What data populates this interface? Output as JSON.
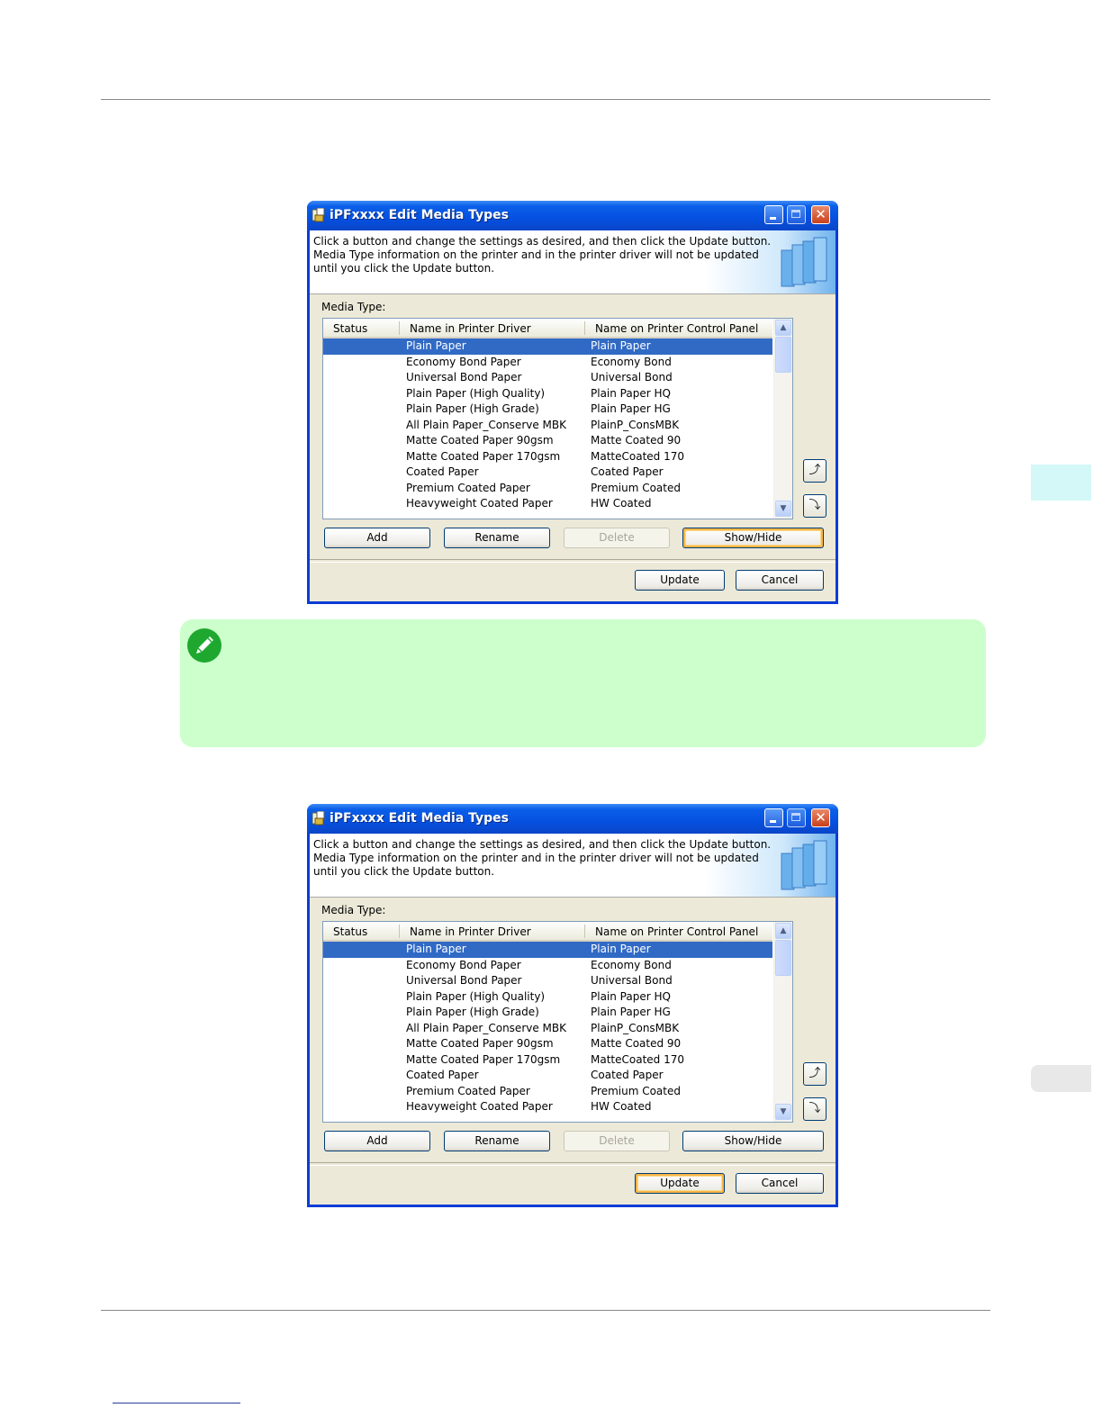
{
  "dialogs": [
    {
      "title": "iPFxxxx Edit Media Types",
      "banner_text": "Click a button and change the settings as desired, and then click the Update button. Media Type information on the printer and in the printer driver will not be updated until you click the Update button.",
      "media_type_label": "Media Type:",
      "columns": [
        "Status",
        "Name in Printer Driver",
        "Name on Printer Control Panel"
      ],
      "rows": [
        {
          "driver": "Plain Paper",
          "panel": "Plain Paper",
          "selected": true
        },
        {
          "driver": "Economy Bond Paper",
          "panel": "Economy Bond"
        },
        {
          "driver": "Universal Bond Paper",
          "panel": "Universal Bond"
        },
        {
          "driver": "Plain Paper (High Quality)",
          "panel": "Plain Paper HQ"
        },
        {
          "driver": "Plain Paper (High Grade)",
          "panel": "Plain Paper HG"
        },
        {
          "driver": "All Plain Paper_Conserve MBK",
          "panel": "PlainP_ConsMBK"
        },
        {
          "driver": "Matte Coated Paper 90gsm",
          "panel": "Matte Coated 90"
        },
        {
          "driver": "Matte Coated Paper 170gsm",
          "panel": "MatteCoated 170"
        },
        {
          "driver": "Coated Paper",
          "panel": "Coated Paper"
        },
        {
          "driver": "Premium Coated Paper",
          "panel": "Premium Coated"
        },
        {
          "driver": "Heavyweight Coated Paper",
          "panel": "HW Coated"
        }
      ],
      "buttons": {
        "add": "Add",
        "rename": "Rename",
        "delete": "Delete",
        "show_hide": "Show/Hide",
        "update": "Update",
        "cancel": "Cancel"
      },
      "focused_button": "show_hide"
    },
    {
      "title": "iPFxxxx Edit Media Types",
      "banner_text": "Click a button and change the settings as desired, and then click the Update button. Media Type information on the printer and in the printer driver will not be updated until you click the Update button.",
      "media_type_label": "Media Type:",
      "columns": [
        "Status",
        "Name in Printer Driver",
        "Name on Printer Control Panel"
      ],
      "rows": [
        {
          "driver": "Plain Paper",
          "panel": "Plain Paper",
          "selected": true
        },
        {
          "driver": "Economy Bond Paper",
          "panel": "Economy Bond"
        },
        {
          "driver": "Universal Bond Paper",
          "panel": "Universal Bond"
        },
        {
          "driver": "Plain Paper (High Quality)",
          "panel": "Plain Paper HQ"
        },
        {
          "driver": "Plain Paper (High Grade)",
          "panel": "Plain Paper HG"
        },
        {
          "driver": "All Plain Paper_Conserve MBK",
          "panel": "PlainP_ConsMBK"
        },
        {
          "driver": "Matte Coated Paper 90gsm",
          "panel": "Matte Coated 90"
        },
        {
          "driver": "Matte Coated Paper 170gsm",
          "panel": "MatteCoated 170"
        },
        {
          "driver": "Coated Paper",
          "panel": "Coated Paper"
        },
        {
          "driver": "Premium Coated Paper",
          "panel": "Premium Coated"
        },
        {
          "driver": "Heavyweight Coated Paper",
          "panel": "HW Coated"
        }
      ],
      "buttons": {
        "add": "Add",
        "rename": "Rename",
        "delete": "Delete",
        "show_hide": "Show/Hide",
        "update": "Update",
        "cancel": "Cancel"
      },
      "focused_button": "update"
    }
  ],
  "icons": {
    "note": "pencil-note-icon",
    "move_up": "move-up-icon",
    "move_down": "move-down-icon"
  },
  "colors": {
    "titlebar": "#0550e0",
    "selection": "#316ac5",
    "note_background": "#ccffcc",
    "note_icon": "#1fa82f"
  }
}
